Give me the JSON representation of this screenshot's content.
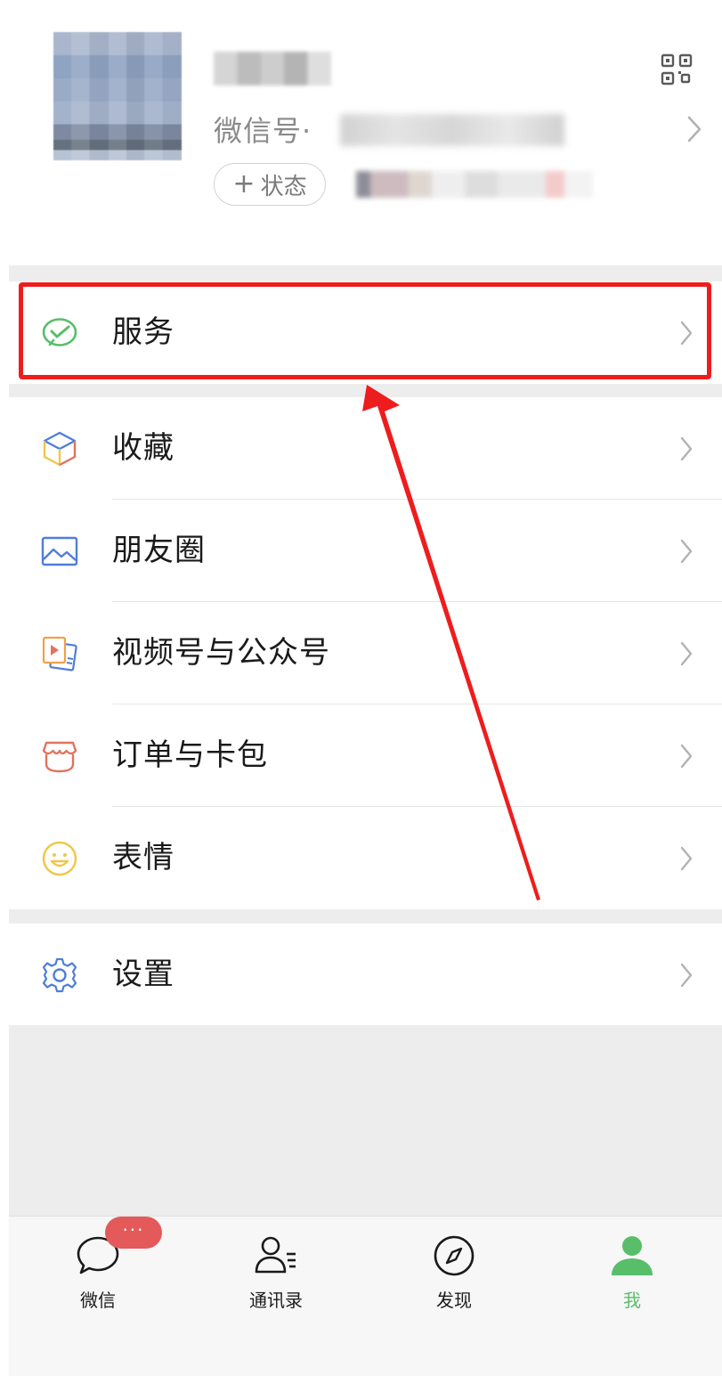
{
  "profile": {
    "wechat_id_label": "微信号·",
    "status_button_plus": "+",
    "status_button_label": "状态",
    "qr_icon": "qr-code-icon",
    "chevron_icon": "chevron-right-icon"
  },
  "menu": {
    "service": {
      "label": "服务",
      "icon": "wechat-pay-check-icon",
      "icon_color": "#57be6a"
    },
    "favorites": {
      "label": "收藏",
      "icon": "cube-icon"
    },
    "moments": {
      "label": "朋友圈",
      "icon": "picture-icon",
      "icon_color": "#4f7ed8"
    },
    "channels": {
      "label": "视频号与公众号",
      "icon": "video-cards-icon"
    },
    "orders": {
      "label": "订单与卡包",
      "icon": "shop-awning-icon",
      "icon_color": "#e2735e"
    },
    "stickers": {
      "label": "表情",
      "icon": "smiley-icon",
      "icon_color": "#f0c64a"
    },
    "settings": {
      "label": "设置",
      "icon": "gear-icon",
      "icon_color": "#4f7ed8"
    }
  },
  "annotation": {
    "highlight_color": "#ee1d1d"
  },
  "tabbar": {
    "chats": {
      "label": "微信",
      "icon": "chat-bubble-icon",
      "badge": "···"
    },
    "contacts": {
      "label": "通讯录",
      "icon": "contacts-icon"
    },
    "discover": {
      "label": "发现",
      "icon": "compass-icon"
    },
    "me": {
      "label": "我",
      "icon": "person-icon",
      "active": true,
      "active_color": "#58be6a"
    }
  }
}
